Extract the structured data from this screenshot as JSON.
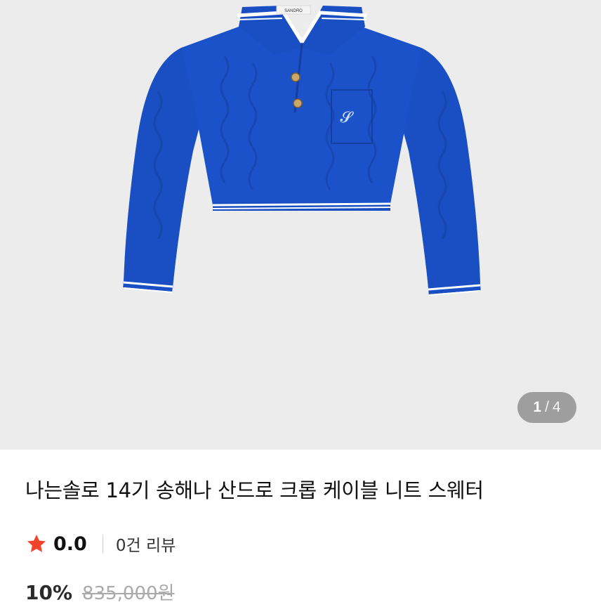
{
  "gallery": {
    "current_page": "1",
    "separator": "/",
    "total_pages": "4",
    "brand_tag": "SANDRO",
    "sweater_color": "#1a4fc4"
  },
  "product": {
    "title": "나는솔로 14기 송해나 산드로 크롭 케이블 니트 스웨터",
    "rating": "0.0",
    "review_count": "0건 리뷰",
    "discount": "10%",
    "original_price": "835,000원"
  },
  "icons": {
    "rating": "star-icon"
  },
  "colors": {
    "star": "#f4432b",
    "gallery_bg": "#ececec",
    "sweater": "#1a4fc4"
  }
}
